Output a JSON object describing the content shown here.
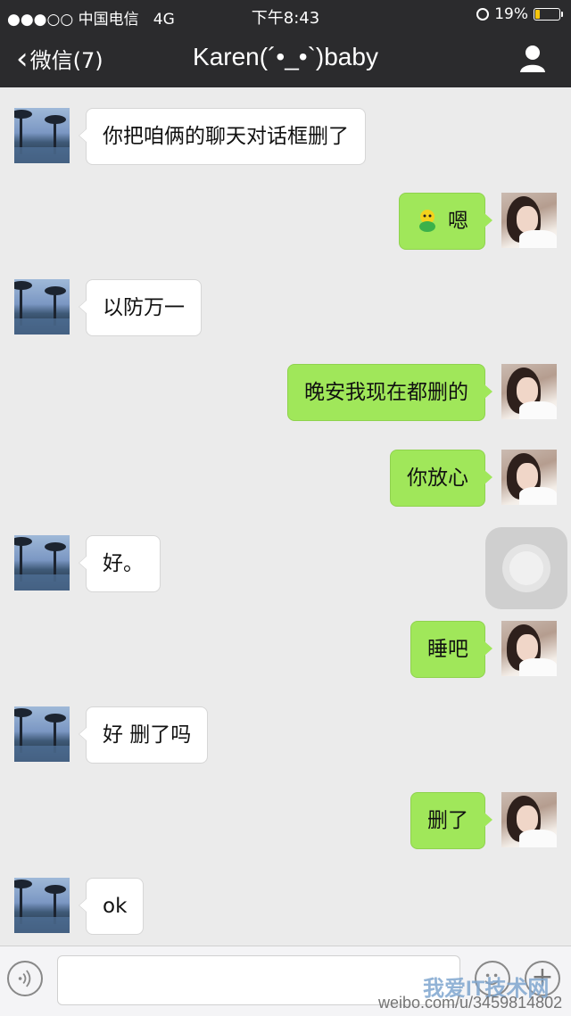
{
  "status_bar": {
    "carrier": "●●●○○ 中国电信",
    "network": "4G",
    "time": "下午8:43",
    "battery": "19%"
  },
  "nav": {
    "back_label": "微信(7)",
    "title": "Karen(´•_•`)baby"
  },
  "messages": [
    {
      "side": "left",
      "text": "你把咱俩的聊天对话框删了"
    },
    {
      "side": "right",
      "text": "嗯",
      "emoji": "green-bean-emoji"
    },
    {
      "side": "left",
      "text": "以防万一"
    },
    {
      "side": "right",
      "text": "晚安我现在都删的"
    },
    {
      "side": "right",
      "text": "你放心"
    },
    {
      "side": "left",
      "text": "好。"
    },
    {
      "side": "right",
      "text": "睡吧"
    },
    {
      "side": "left",
      "text": "好 删了吗"
    },
    {
      "side": "right",
      "text": "删了"
    },
    {
      "side": "left",
      "text": "ok"
    }
  ],
  "input_bar": {
    "text_value": "",
    "plus_label": "+"
  },
  "watermark": {
    "site": "我爱IT技术网",
    "url": "weibo.com/u/3459814802"
  },
  "colors": {
    "nav_bg": "#2b2b2d",
    "chat_bg": "#ebebeb",
    "outgoing_bubble": "#a0e75a",
    "incoming_bubble": "#ffffff",
    "battery_fill": "#f5c60c"
  }
}
